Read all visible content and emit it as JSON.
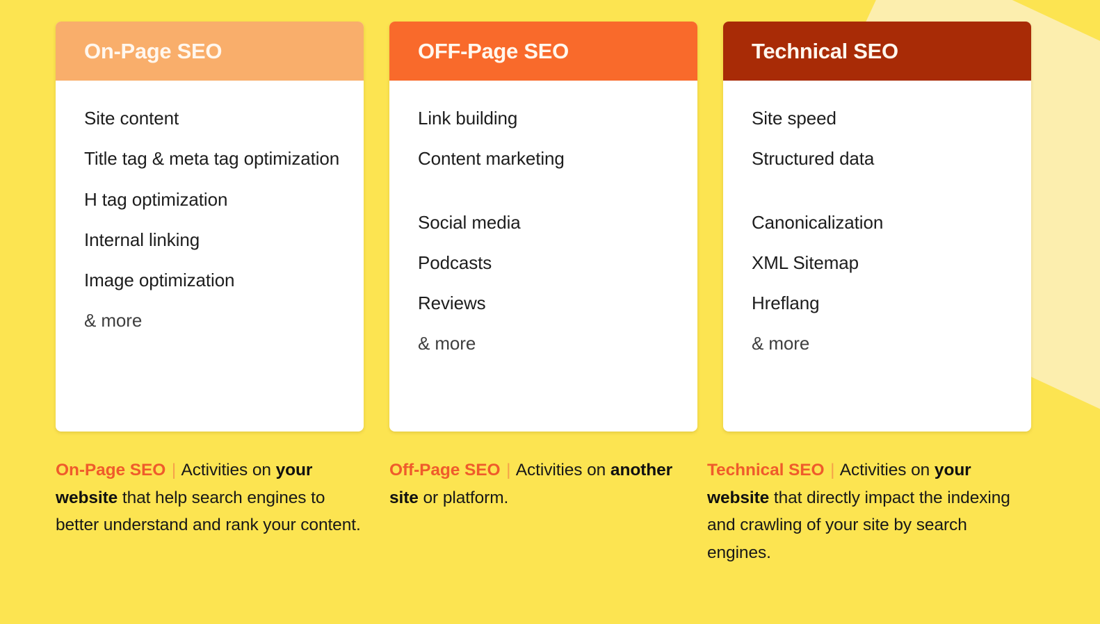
{
  "background": {
    "base_color": "#FCE451",
    "accent_shape_color": "#FCEEAE"
  },
  "columns": [
    {
      "id": "on-page-seo",
      "header": {
        "title": "On-Page SEO",
        "bg_color": "#F9AE6B",
        "text_color": "#FFF7EE"
      },
      "items": [
        "Site content",
        "Title tag & meta tag optimization",
        "H tag optimization",
        "Internal linking",
        "Image optimization"
      ],
      "more_label": "& more",
      "caption": {
        "lead": "On-Page SEO",
        "divider": "|",
        "parts": [
          {
            "text": " Activities on ",
            "bold": false
          },
          {
            "text": "your website",
            "bold": true
          },
          {
            "text": " that help search engines to better understand and rank your content.",
            "bold": false
          }
        ]
      }
    },
    {
      "id": "off-page-seo",
      "header": {
        "title": "OFF-Page SEO",
        "bg_color": "#F96A2B",
        "text_color": "#FFF7EE"
      },
      "items": [
        "Link building",
        "Content marketing",
        "",
        "Social media",
        "Podcasts",
        "Reviews"
      ],
      "more_label": "& more",
      "caption": {
        "lead": "Off-Page SEO",
        "divider": "|",
        "parts": [
          {
            "text": " Activities on ",
            "bold": false
          },
          {
            "text": "another site",
            "bold": true
          },
          {
            "text": " or platform.",
            "bold": false
          }
        ]
      }
    },
    {
      "id": "technical-seo",
      "header": {
        "title": "Technical SEO",
        "bg_color": "#A82B06",
        "text_color": "#FFF7EE"
      },
      "items": [
        "Site speed",
        "Structured data",
        "",
        "Canonicalization",
        "XML Sitemap",
        "Hreflang"
      ],
      "more_label": "& more",
      "caption": {
        "lead": "Technical SEO",
        "divider": "|",
        "parts": [
          {
            "text": " Activities on ",
            "bold": false
          },
          {
            "text": "your website",
            "bold": true
          },
          {
            "text": " that directly impact the indexing and crawling of your site by search engines.",
            "bold": false
          }
        ]
      }
    }
  ]
}
